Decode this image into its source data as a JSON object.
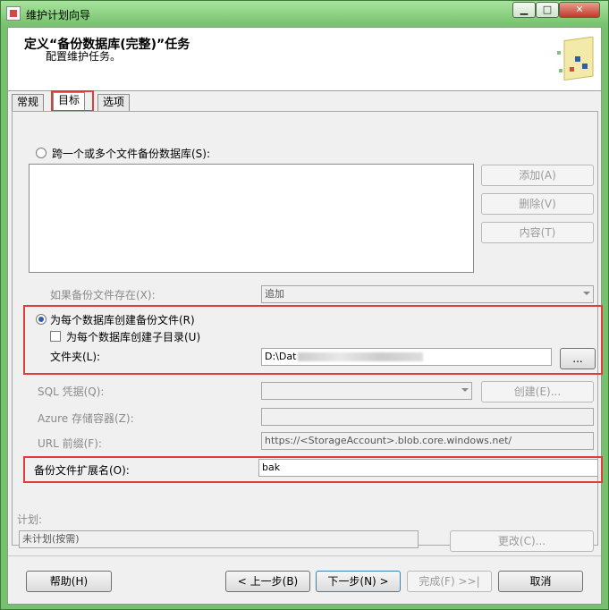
{
  "window": {
    "title": "维护计划向导"
  },
  "header": {
    "title": "定义“备份数据库(完整)”任务",
    "subtitle": "配置维护任务。"
  },
  "tabs": [
    {
      "label": "常规"
    },
    {
      "label": "目标",
      "active": true
    },
    {
      "label": "选项"
    }
  ],
  "target": {
    "span_label": "跨一个或多个文件备份数据库(S):",
    "add_label": "添加(A)",
    "remove_label": "删除(V)",
    "contents_label": "内容(T)",
    "if_exists_label": "如果备份文件存在(X):",
    "if_exists_value": "追加",
    "per_db_label": "为每个数据库创建备份文件(R)",
    "subdir_label": "为每个数据库创建子目录(U)",
    "folder_label": "文件夹(L):",
    "folder_value": "D:\\Dat",
    "browse_label": "...",
    "sql_cred_label": "SQL 凭据(Q):",
    "create_label": "创建(E)...",
    "azure_label": "Azure 存储容器(Z):",
    "url_prefix_label": "URL 前缀(F):",
    "url_prefix_value": "https://<StorageAccount>.blob.core.windows.net/",
    "ext_label": "备份文件扩展名(O):",
    "ext_value": "bak"
  },
  "schedule": {
    "label": "计划:",
    "value": "未计划(按需)",
    "change_label": "更改(C)..."
  },
  "footer": {
    "help": "帮助(H)",
    "back": "< 上一步(B)",
    "next": "下一步(N) >",
    "finish": "完成(F) >>|",
    "cancel": "取消"
  },
  "colors": {
    "highlight": "#e03c3c",
    "accent": "#2b5fad"
  }
}
